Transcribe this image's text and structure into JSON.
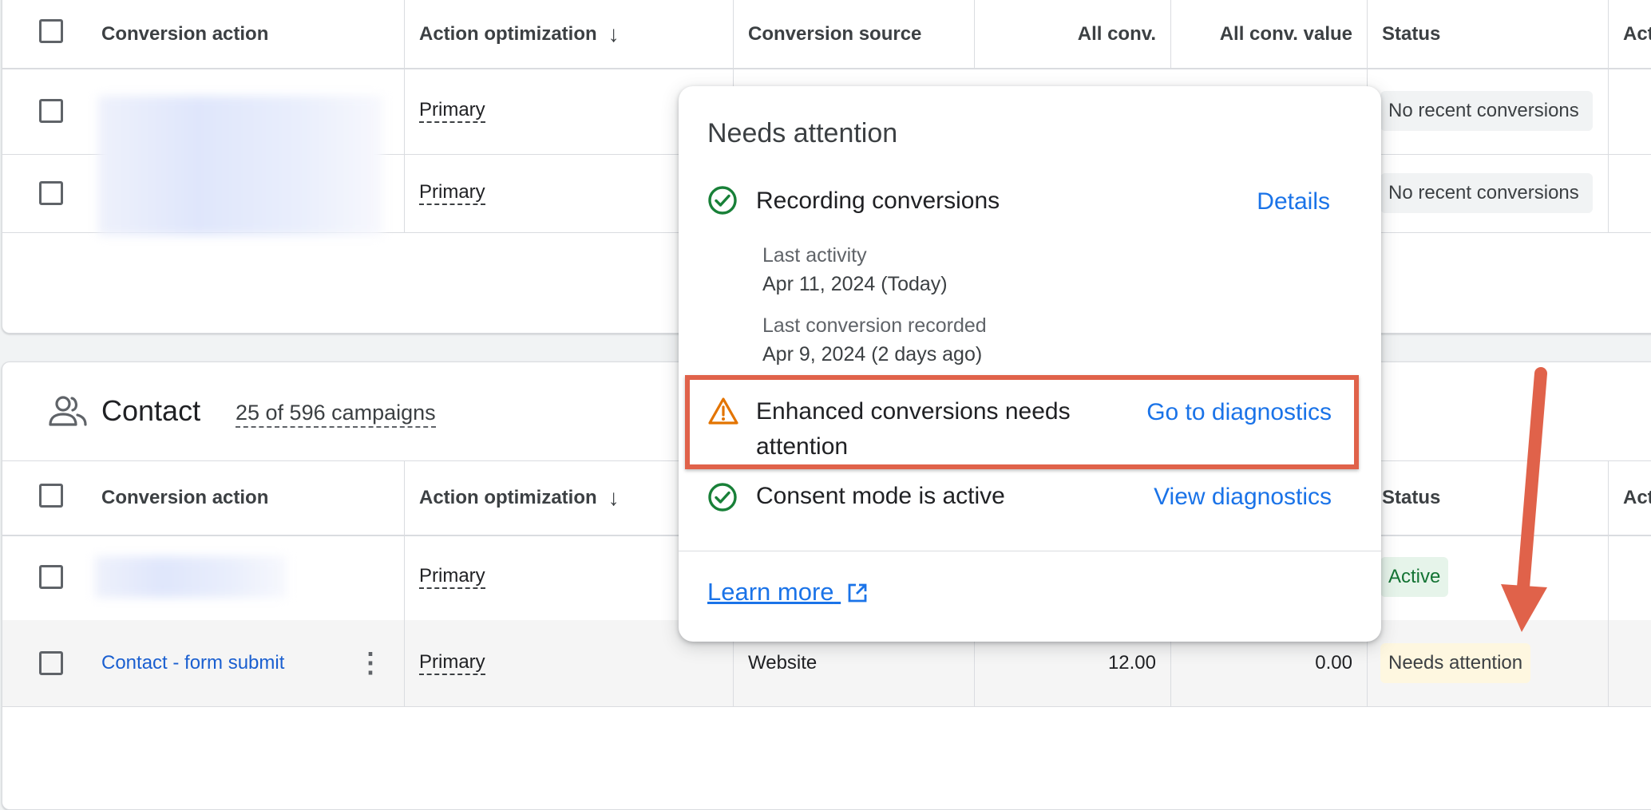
{
  "columns": {
    "conversion_action": "Conversion action",
    "action_optimization": "Action optimization",
    "conversion_source": "Conversion source",
    "all_conv": "All conv.",
    "all_conv_value": "All conv. value",
    "status": "Status",
    "actions_partial": "Act"
  },
  "sort_icon": "↓",
  "top_table": {
    "rows": [
      {
        "optimization": "Primary",
        "status": "No recent conversions"
      },
      {
        "optimization": "Primary",
        "status": "No recent conversions"
      }
    ]
  },
  "contact_section": {
    "icon": "people-icon",
    "title": "Contact",
    "campaigns": "25 of 596 campaigns",
    "rows": [
      {
        "optimization": "Primary",
        "status": "Active"
      },
      {
        "action": "Contact - form submit",
        "optimization": "Primary",
        "source": "Website",
        "all_conv": "12.00",
        "all_conv_value": "0.00",
        "status": "Needs attention"
      }
    ]
  },
  "popup": {
    "title": "Needs attention",
    "recording": {
      "label": "Recording conversions",
      "link": "Details",
      "last_activity_label": "Last activity",
      "last_activity_value": "Apr 11, 2024 (Today)",
      "last_conversion_label": "Last conversion recorded",
      "last_conversion_value": "Apr 9, 2024 (2 days ago)"
    },
    "enhanced": {
      "label_line1": "Enhanced conversions needs",
      "label_line2": "attention",
      "link": "Go to diagnostics"
    },
    "consent": {
      "label": "Consent mode is active",
      "link": "View diagnostics"
    },
    "learn_more": "Learn more"
  },
  "colors": {
    "link": "#1a73e8",
    "success": "#188038",
    "warning": "#e37400",
    "highlight": "#e0624a"
  }
}
